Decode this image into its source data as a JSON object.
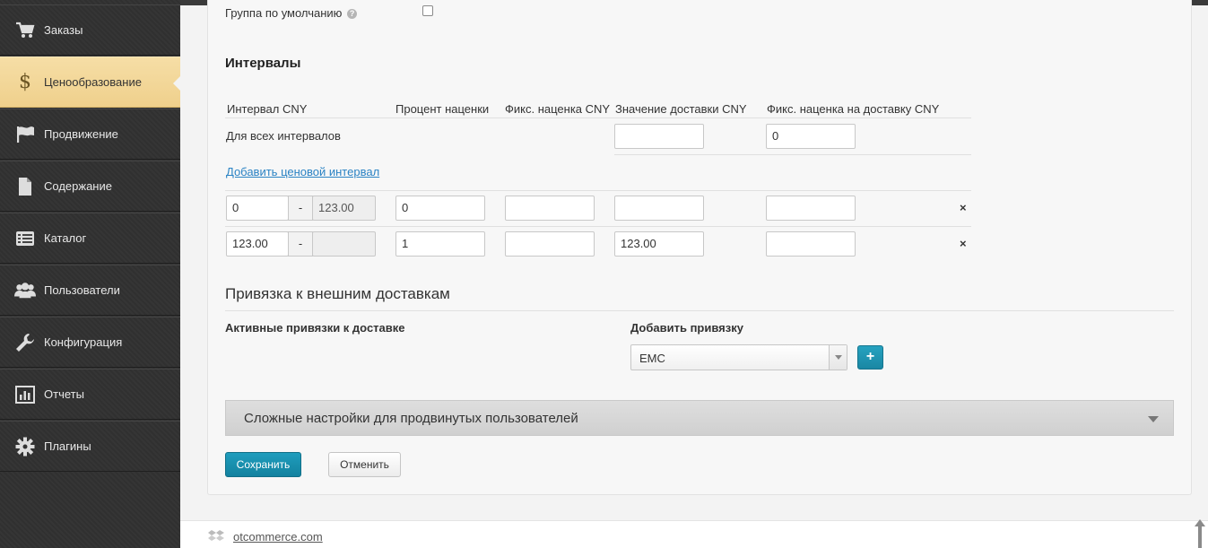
{
  "sidebar": {
    "items": [
      {
        "label": "Заказы",
        "icon": "cart-icon"
      },
      {
        "label": "Ценообразование",
        "icon": "dollar-icon"
      },
      {
        "label": "Продвижение",
        "icon": "flag-icon"
      },
      {
        "label": "Содержание",
        "icon": "document-icon"
      },
      {
        "label": "Каталог",
        "icon": "list-icon"
      },
      {
        "label": "Пользователи",
        "icon": "users-icon"
      },
      {
        "label": "Конфигурация",
        "icon": "wrench-icon"
      },
      {
        "label": "Отчеты",
        "icon": "bar-chart-icon"
      },
      {
        "label": "Плагины",
        "icon": "gear-icon"
      }
    ],
    "active_index": 1
  },
  "default_group": {
    "label": "Группа по умолчанию",
    "help": "?",
    "checked": false
  },
  "intervals": {
    "title": "Интервалы",
    "headers": [
      "Интервал CNY",
      "Процент наценки",
      "Фикс. наценка CNY",
      "Значение доставки CNY",
      "Фикс. наценка на доставку CNY"
    ],
    "all_label": "Для всех интервалов",
    "all_delivery_value": "",
    "all_fixed_delivery_value": "0",
    "add_link": "Добавить ценовой интервал",
    "rows": [
      {
        "from": "0",
        "sep": "-",
        "to": "123.00",
        "percent": "0",
        "fixed": "",
        "delivery": "",
        "fixed_delivery": "",
        "remove": "×"
      },
      {
        "from": "123.00",
        "sep": "-",
        "to": "",
        "percent": "1",
        "fixed": "",
        "delivery": "123.00",
        "fixed_delivery": "",
        "remove": "×"
      }
    ]
  },
  "binding": {
    "title": "Привязка к внешним доставкам",
    "active_label": "Активные привязки к доставке",
    "add_label": "Добавить привязку",
    "select_value": "EMC",
    "plus_label": "+"
  },
  "advanced": {
    "label": "Сложные настройки для продвинутых пользователей"
  },
  "actions": {
    "save": "Сохранить",
    "cancel": "Отменить"
  },
  "footer": {
    "link": "otcommerce.com"
  },
  "colors": {
    "accent": "#1a8fae",
    "active_nav": "#f2d595",
    "sidebar": "#333333"
  }
}
